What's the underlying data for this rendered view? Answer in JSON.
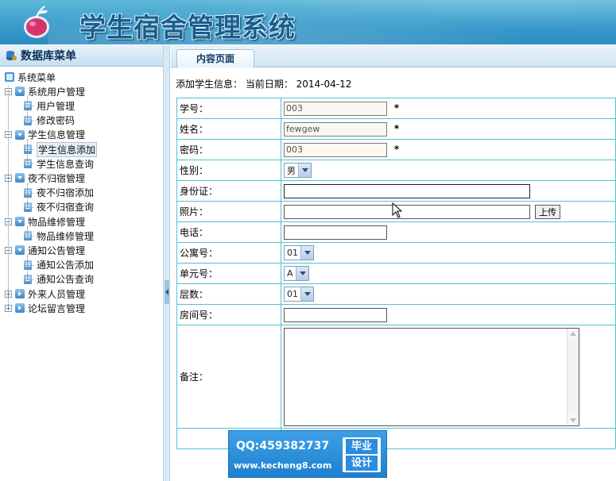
{
  "header": {
    "title": "学生宿舍管理系统",
    "logo_icon": "apple-logo-icon"
  },
  "sidebar": {
    "title": "数据库菜单",
    "root_label": "系统菜单",
    "groups": [
      {
        "label": "系统用户管理",
        "expanded": true,
        "items": [
          "用户管理",
          "修改密码"
        ]
      },
      {
        "label": "学生信息管理",
        "expanded": true,
        "items": [
          "学生信息添加",
          "学生信息查询"
        ]
      },
      {
        "label": "夜不归宿管理",
        "expanded": true,
        "items": [
          "夜不归宿添加",
          "夜不归宿查询"
        ]
      },
      {
        "label": "物品维修管理",
        "expanded": true,
        "items": [
          "物品维修管理"
        ]
      },
      {
        "label": "通知公告管理",
        "expanded": true,
        "items": [
          "通知公告添加",
          "通知公告查询"
        ]
      },
      {
        "label": "外来人员管理",
        "expanded": false,
        "items": []
      },
      {
        "label": "论坛留言管理",
        "expanded": false,
        "items": []
      }
    ],
    "selected": "学生信息添加"
  },
  "main": {
    "tab_label": "内容页面",
    "info_text": "添加学生信息：  当前日期：  2014-04-12",
    "form": {
      "student_id": {
        "label": "学号：",
        "value": "003",
        "required": "*"
      },
      "name": {
        "label": "姓名：",
        "value": "fewgew",
        "required": "*"
      },
      "password": {
        "label": "密码：",
        "value": "003",
        "required": "*"
      },
      "gender": {
        "label": "性别：",
        "value": "男"
      },
      "id_card": {
        "label": "身份证：",
        "value": ""
      },
      "photo": {
        "label": "照片：",
        "value": "",
        "button": "上传"
      },
      "phone": {
        "label": "电话：",
        "value": ""
      },
      "apartment": {
        "label": "公寓号：",
        "value": "01"
      },
      "unit": {
        "label": "单元号：",
        "value": "A"
      },
      "floor": {
        "label": "层数：",
        "value": "01"
      },
      "room": {
        "label": "房间号：",
        "value": ""
      },
      "remark": {
        "label": "备注：",
        "value": ""
      }
    }
  },
  "watermark": {
    "qq": "QQ:459382737",
    "url": "www.kecheng8.com",
    "badge_top": "毕业",
    "badge_bottom": "设计"
  }
}
